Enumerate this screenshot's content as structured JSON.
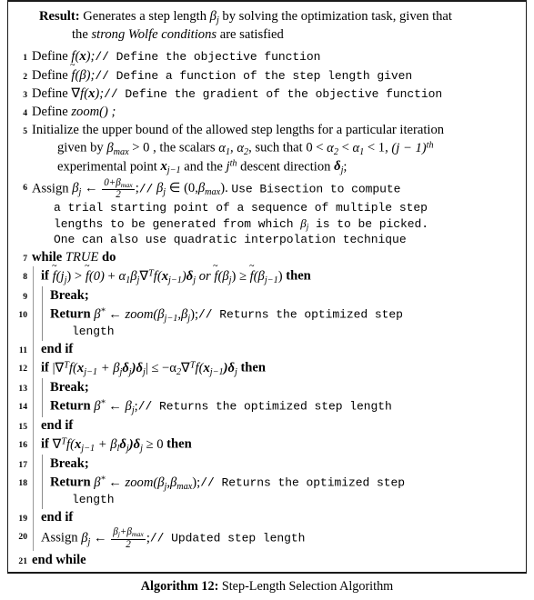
{
  "algorithm": {
    "caption_label": "Algorithm 12:",
    "caption_title": "Step-Length Selection Algorithm",
    "result": {
      "label": "Result:",
      "text_part1": "Generates a step length ",
      "beta_j": "β",
      "sub_j": "j",
      "text_part2": " by solving the optimization task, given that",
      "line2_pre": "the ",
      "line2_italic": "strong Wolfe conditions",
      "line2_post": " are satisfied"
    },
    "lines": [
      {
        "number": "1",
        "keyword": "Define",
        "math": "f(x);",
        "comment": "// Define the objective function"
      },
      {
        "number": "2",
        "keyword": "Define",
        "math": "f̃(β);",
        "comment": "// Define a function of the step length given"
      },
      {
        "number": "3",
        "keyword": "Define",
        "math": "∇f(x);",
        "comment": "// Define the gradient of the objective function"
      },
      {
        "number": "4",
        "keyword": "Define",
        "math": "zoom() ;",
        "comment": ""
      },
      {
        "number": "5",
        "text_l1": "Initialize the upper bound of the allowed step lengths for a particular iteration",
        "text_l2_a": "given by ",
        "text_l2_beta": "β",
        "text_l2_betasub": "max",
        "text_l2_b": " > 0 , the scalars ",
        "text_l2_alpha1": "α",
        "text_l2_alpha1sub": "1",
        "text_l2_c": ", ",
        "text_l2_alpha2": "α",
        "text_l2_alpha2sub": "2",
        "text_l2_d": ", such that 0 < ",
        "text_l2_e": " < ",
        "text_l2_f": " < 1, ",
        "text_l2_jm1": "(j − 1)",
        "text_l2_th": "th",
        "text_l3_a": "experimental point ",
        "text_l3_x": "x",
        "text_l3_xsub": "j−1",
        "text_l3_b": " and the ",
        "text_l3_j": "j",
        "text_l3_jth": "th",
        "text_l3_c": " descent direction ",
        "text_l3_delta": "δ",
        "text_l3_deltasub": "j",
        "text_l3_end": ";"
      },
      {
        "number": "6",
        "keyword": "Assign",
        "assign_beta": "β",
        "assign_sub": "j",
        "arrow": "←",
        "frac_num": "0+β",
        "frac_num_sub": "max",
        "frac_den": "2",
        "semicolon": ";",
        "comment_inline": "//",
        "comment_math_beta": "β",
        "comment_math_sub": "j",
        "comment_math_in": " ∈ (0,",
        "comment_math_bmax": "β",
        "comment_math_bmaxsub": "max",
        "comment_math_close": ").",
        "comment_rest": "Use Bisection to compute",
        "comment_l2": "a trial starting point of a sequence of multiple step",
        "comment_l3_a": "lengths to be generated from which ",
        "comment_l3_beta": "β",
        "comment_l3_sub": "j",
        "comment_l3_b": " is to be picked.",
        "comment_l4": "One can also use quadratic interpolation technique"
      },
      {
        "number": "7",
        "keyword": "while",
        "condition": "TRUE",
        "keyword_end": "do"
      },
      {
        "number": "8",
        "keyword": "if",
        "cond_tf1": "f̃(β",
        "cond_sub1": "j",
        "cond_gt": ") > ",
        "cond_tf2": "f̃(0)",
        "cond_plus": " + ",
        "cond_alpha": "α",
        "cond_alphasub": "1",
        "cond_beta": "β",
        "cond_betasub": "j",
        "cond_grad": "∇",
        "cond_gradsup": "T",
        "cond_f": "f(x",
        "cond_xsub": "j−1",
        "cond_delta": ")δ",
        "cond_deltasub": "j",
        "cond_or": " or ",
        "cond_tf3": "f̃(β",
        "cond_sub3": "j",
        "cond_geq": ") ≥ ",
        "cond_tf4": "f̃(β",
        "cond_sub4": "j−1",
        "cond_close": ")",
        "keyword_end": "then"
      },
      {
        "number": "9",
        "keyword": "Break;"
      },
      {
        "number": "10",
        "keyword": "Return",
        "beta_star": "β",
        "star": "*",
        "arrow": "←",
        "func": "zoom(β",
        "sub1": "j−1",
        "mid": ",β",
        "sub2": "j",
        "close": ");",
        "comment": "// Returns the optimized step",
        "comment_l2": "length"
      },
      {
        "number": "11",
        "keyword": "end if"
      },
      {
        "number": "12",
        "keyword": "if",
        "cond_a": "|∇",
        "cond_sup": "T",
        "cond_b": "f(x",
        "cond_xsub": "j−1",
        "cond_c": " + β",
        "cond_bsub": "j",
        "cond_d": "δ",
        "cond_dsub": "j",
        "cond_e": ")δ",
        "cond_esub": "j",
        "cond_f": "| ≤ −α",
        "cond_alphasub": "2",
        "cond_g": "∇",
        "cond_gsup": "T",
        "cond_h": "f(x",
        "cond_hsub": "j−1",
        "cond_i": ")δ",
        "cond_isub": "j",
        "keyword_end": "then"
      },
      {
        "number": "13",
        "keyword": "Break;"
      },
      {
        "number": "14",
        "keyword": "Return",
        "beta_star": "β",
        "star": "*",
        "arrow": "←",
        "beta": "β",
        "sub": "j",
        "semi": ";",
        "comment": "// Returns the optimized step length"
      },
      {
        "number": "15",
        "keyword": "end if"
      },
      {
        "number": "16",
        "keyword": "if",
        "cond_a": "∇",
        "cond_sup": "T",
        "cond_b": "f(x",
        "cond_xsub": "j−1",
        "cond_c": " + β",
        "cond_bsub": "l",
        "cond_d": "δ",
        "cond_dsub": "j",
        "cond_e": ")δ",
        "cond_esub": "j",
        "cond_f": " ≥ 0",
        "keyword_end": "then"
      },
      {
        "number": "17",
        "keyword": "Break;"
      },
      {
        "number": "18",
        "keyword": "Return",
        "beta_star": "β",
        "star": "*",
        "arrow": "←",
        "func": "zoom(β",
        "sub1": "j",
        "mid": ",β",
        "sub2": "max",
        "close": ");",
        "comment": "// Returns the optimized step",
        "comment_l2": "length"
      },
      {
        "number": "19",
        "keyword": "end if"
      },
      {
        "number": "20",
        "keyword": "Assign",
        "beta": "β",
        "sub": "j",
        "arrow": "←",
        "frac_num_a": "β",
        "frac_num_asub": "j",
        "frac_num_b": "+β",
        "frac_num_bsub": "max",
        "frac_den": "2",
        "semi": ";",
        "comment": "// Updated step length"
      },
      {
        "number": "21",
        "keyword": "end while"
      }
    ]
  }
}
